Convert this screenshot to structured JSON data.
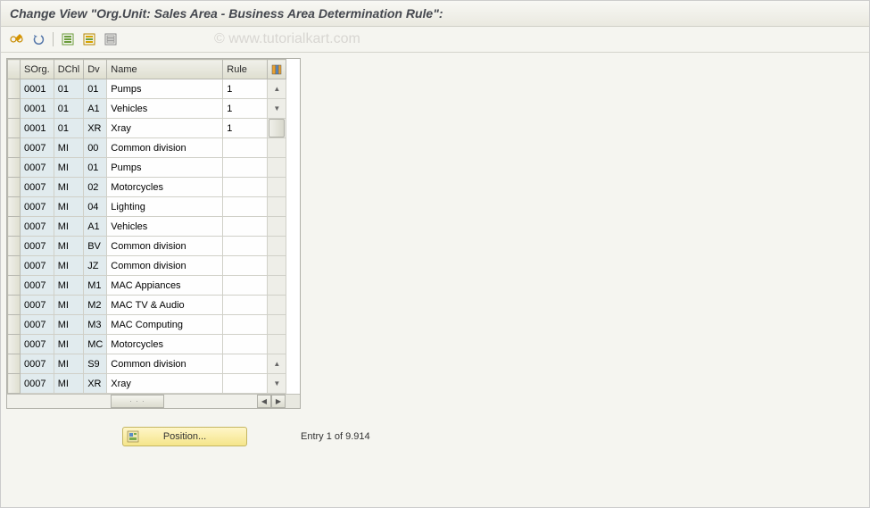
{
  "title": "Change View \"Org.Unit: Sales Area - Business Area Determination Rule\":",
  "watermark": "© www.tutorialkart.com",
  "toolbar": {
    "change": "Change",
    "undo": "Undo",
    "select_all": "Select All",
    "select_block": "Select Block",
    "deselect_all": "Deselect All"
  },
  "table": {
    "headers": {
      "sorg": "SOrg.",
      "dchl": "DChl",
      "dv": "Dv",
      "name": "Name",
      "rule": "Rule"
    },
    "rows": [
      {
        "sorg": "0001",
        "dchl": "01",
        "dv": "01",
        "name": "Pumps",
        "rule": "1"
      },
      {
        "sorg": "0001",
        "dchl": "01",
        "dv": "A1",
        "name": "Vehicles",
        "rule": "1"
      },
      {
        "sorg": "0001",
        "dchl": "01",
        "dv": "XR",
        "name": "Xray",
        "rule": "1"
      },
      {
        "sorg": "0007",
        "dchl": "MI",
        "dv": "00",
        "name": "Common division",
        "rule": ""
      },
      {
        "sorg": "0007",
        "dchl": "MI",
        "dv": "01",
        "name": "Pumps",
        "rule": ""
      },
      {
        "sorg": "0007",
        "dchl": "MI",
        "dv": "02",
        "name": "Motorcycles",
        "rule": ""
      },
      {
        "sorg": "0007",
        "dchl": "MI",
        "dv": "04",
        "name": "Lighting",
        "rule": ""
      },
      {
        "sorg": "0007",
        "dchl": "MI",
        "dv": "A1",
        "name": "Vehicles",
        "rule": ""
      },
      {
        "sorg": "0007",
        "dchl": "MI",
        "dv": "BV",
        "name": "Common division",
        "rule": ""
      },
      {
        "sorg": "0007",
        "dchl": "MI",
        "dv": "JZ",
        "name": "Common division",
        "rule": ""
      },
      {
        "sorg": "0007",
        "dchl": "MI",
        "dv": "M1",
        "name": "MAC Appiances",
        "rule": ""
      },
      {
        "sorg": "0007",
        "dchl": "MI",
        "dv": "M2",
        "name": "MAC TV & Audio",
        "rule": ""
      },
      {
        "sorg": "0007",
        "dchl": "MI",
        "dv": "M3",
        "name": "MAC Computing",
        "rule": ""
      },
      {
        "sorg": "0007",
        "dchl": "MI",
        "dv": "MC",
        "name": "Motorcycles",
        "rule": ""
      },
      {
        "sorg": "0007",
        "dchl": "MI",
        "dv": "S9",
        "name": "Common division",
        "rule": ""
      },
      {
        "sorg": "0007",
        "dchl": "MI",
        "dv": "XR",
        "name": "Xray",
        "rule": ""
      }
    ]
  },
  "footer": {
    "position_label": "Position...",
    "entry_label": "Entry 1 of 9.914"
  }
}
